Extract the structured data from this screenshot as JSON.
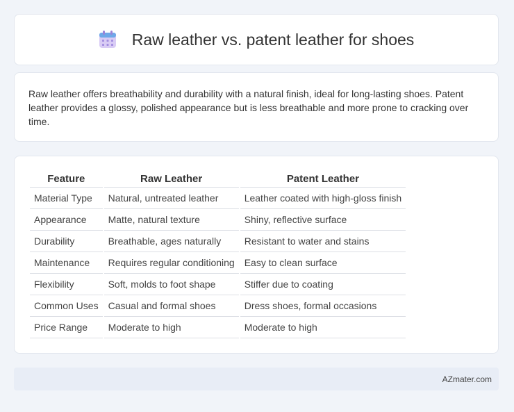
{
  "header": {
    "title": "Raw leather vs. patent leather for shoes",
    "icon": "calendar-icon"
  },
  "summary": {
    "text": "Raw leather offers breathability and durability with a natural finish, ideal for long-lasting shoes. Patent leather provides a glossy, polished appearance but is less breathable and more prone to cracking over time."
  },
  "table": {
    "headers": [
      "Feature",
      "Raw Leather",
      "Patent Leather"
    ],
    "rows": [
      [
        "Material Type",
        "Natural, untreated leather",
        "Leather coated with high-gloss finish"
      ],
      [
        "Appearance",
        "Matte, natural texture",
        "Shiny, reflective surface"
      ],
      [
        "Durability",
        "Breathable, ages naturally",
        "Resistant to water and stains"
      ],
      [
        "Maintenance",
        "Requires regular conditioning",
        "Easy to clean surface"
      ],
      [
        "Flexibility",
        "Soft, molds to foot shape",
        "Stiffer due to coating"
      ],
      [
        "Common Uses",
        "Casual and formal shoes",
        "Dress shoes, formal occasions"
      ],
      [
        "Price Range",
        "Moderate to high",
        "Moderate to high"
      ]
    ]
  },
  "footer": {
    "brand": "AZmater.com"
  },
  "colors": {
    "background": "#f1f4f9",
    "card": "#ffffff",
    "footer": "#e8edf6",
    "icon_top": "#6fa8e8",
    "icon_body": "#c9b6ef"
  }
}
